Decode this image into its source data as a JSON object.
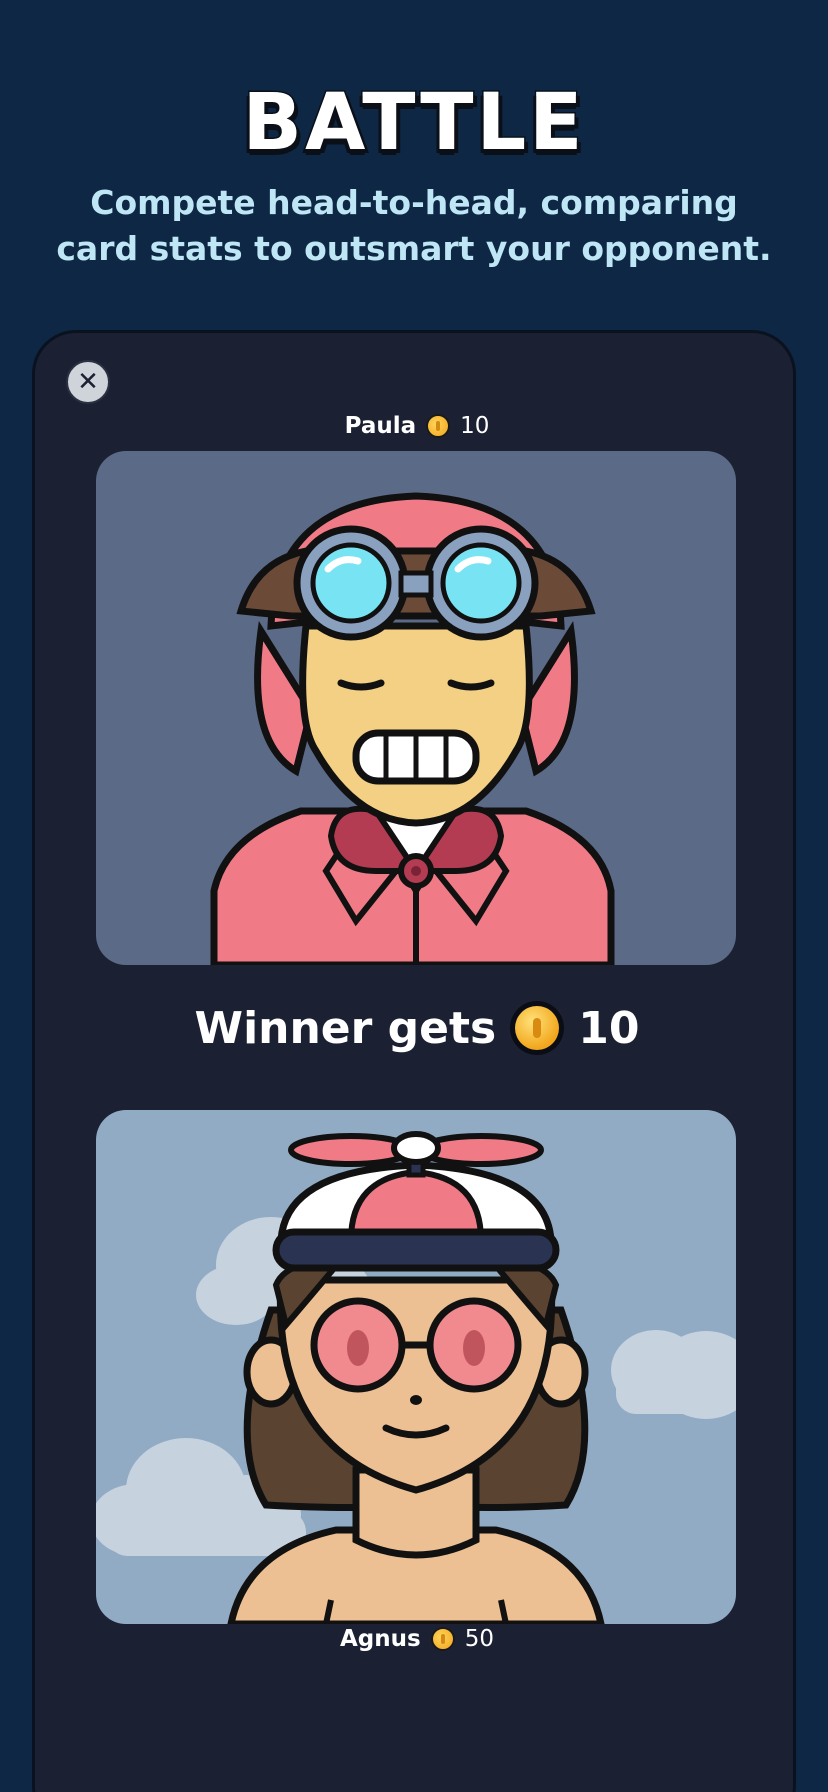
{
  "header": {
    "title": "BATTLE",
    "subtitle_line1": "Compete head-to-head, comparing",
    "subtitle_line2": "card stats to outsmart your opponent."
  },
  "battle": {
    "close_icon": "close-icon",
    "opponent": {
      "name": "Paula",
      "coins": "10",
      "coin_icon": "coin-icon"
    },
    "winner_text": "Winner gets",
    "winner_amount": "10",
    "player": {
      "name": "Agnus",
      "coins": "50",
      "coin_icon": "coin-icon"
    }
  },
  "colors": {
    "background": "#0d2744",
    "panel": "#1b2133",
    "subtitle": "#bfe6f5",
    "coin": "#f2a61c",
    "card_top_bg": "#5b6a86",
    "card_bottom_bg": "#92abc4"
  }
}
